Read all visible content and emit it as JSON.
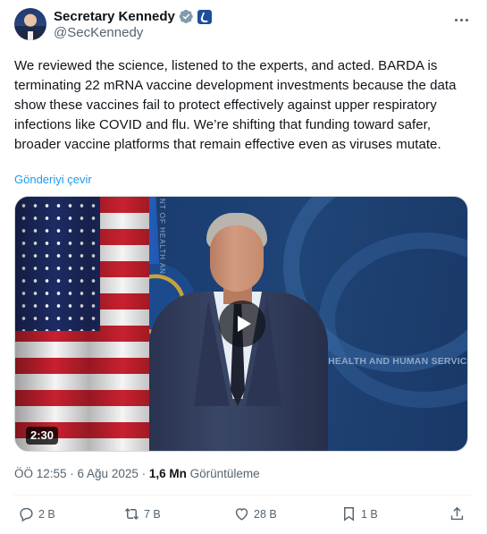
{
  "author": {
    "display_name": "Secretary Kennedy",
    "handle": "@SecKennedy"
  },
  "tweet": {
    "text": "We reviewed the science, listened to the experts, and acted. BARDA is terminating 22 mRNA vaccine development investments because the data show these vaccines fail to protect effectively against upper respiratory infections like COVID and flu. We’re shifting that funding toward safer, broader vaccine platforms that remain effective even as viruses mutate.",
    "translate_label": "Gönderiyi çevir"
  },
  "media": {
    "duration": "2:30",
    "backdrop_text": "OF HEALTH AND HUMAN SERVICES",
    "vertical_text": "NT OF HEALTH AN"
  },
  "meta": {
    "timestamp": "ÖÖ 12:55 · 6 Ağu 2025 · ",
    "views_count": "1,6 Mn",
    "views_label": " Görüntüleme"
  },
  "actions": {
    "reply_count": "2 B",
    "repost_count": "7 B",
    "like_count": "28 B",
    "bookmark_count": "1 B"
  },
  "colors": {
    "accent": "#1d9bf0",
    "secondary_text": "#536471",
    "primary_text": "#0f1419"
  },
  "icons": [
    "verified-badge-icon",
    "government-badge-icon",
    "more-options-icon",
    "play-icon",
    "reply-icon",
    "repost-icon",
    "like-icon",
    "bookmark-icon",
    "share-icon"
  ]
}
